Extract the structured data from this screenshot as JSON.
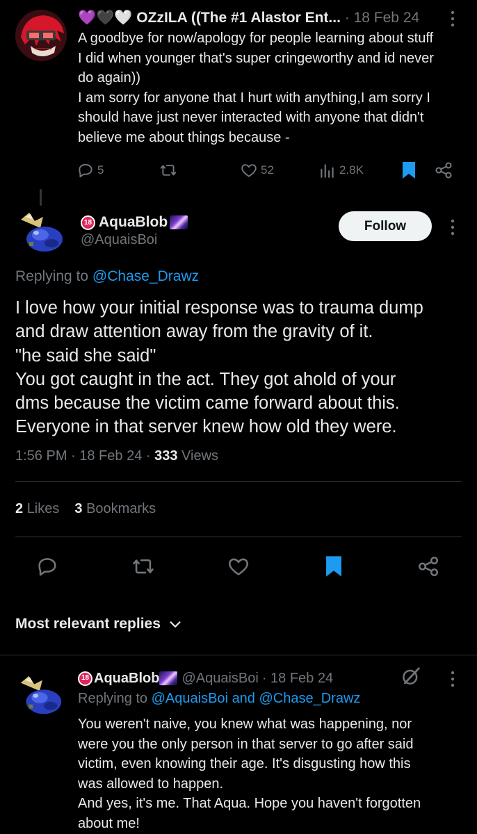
{
  "colors": {
    "background": "#000000",
    "text": "#e7e9ea",
    "muted": "#71767b",
    "accent": "#1d9bf0",
    "bookmark": "#1d9bf0"
  },
  "tweet_top": {
    "hearts": "💜🖤🤍",
    "name": "OZzILA ((The #1 Alastor Ent...",
    "date": "· 18 Feb 24",
    "lines": [
      "A goodbye for now/apology for people learning about stuff",
      "I did when younger that's super cringeworthy and id never",
      "do again))",
      "I am sorry for anyone that I hurt with anything,I am sorry I",
      "should have just never interacted with anyone that didn't",
      "believe me about things because -"
    ],
    "replies": "5",
    "likes": "52",
    "views": "2.8K",
    "icons": [
      "reply-icon",
      "retweet-icon",
      "heart-icon",
      "views-icon",
      "bookmark-icon",
      "share-icon"
    ]
  },
  "tweet_main": {
    "name": "AquaBlob",
    "handle": "@AquaisBoi",
    "follow_label": "Follow",
    "replying_prefix": "Replying to",
    "replying_to": "@Chase_Drawz",
    "lines": [
      "I love how your initial response was to trauma dump",
      "and draw attention away from the gravity of it.",
      "\"he said she said\"",
      "You got caught in the act. They got ahold of your",
      "dms because the victim came forward about this.",
      "Everyone in that server knew how old they were."
    ],
    "time": "1:56 PM · 18 Feb 24 ·",
    "views_count": "333",
    "views_label": "Views",
    "likes_count": "2",
    "likes_label": "Likes",
    "bookmarks_count": "3",
    "bookmarks_label": "Bookmarks"
  },
  "most_relevant": "Most relevant replies",
  "reply": {
    "name": "AquaBlob",
    "handle": "@AquaisBoi",
    "date": "· 18 Feb 24",
    "replying_prefix": "Replying to",
    "replying_to_1": "@AquaisBoi",
    "replying_and": "and",
    "replying_to_2": "@Chase_Drawz",
    "lines": [
      "You weren't naive, you knew what was happening, nor",
      "were you the only person in that server to go after said",
      "victim, even knowing their age. It's disgusting how this",
      "was allowed to happen.",
      "And yes, it's me. That Aqua. Hope you haven't forgotten",
      "about me!"
    ]
  },
  "badge_18": "18"
}
